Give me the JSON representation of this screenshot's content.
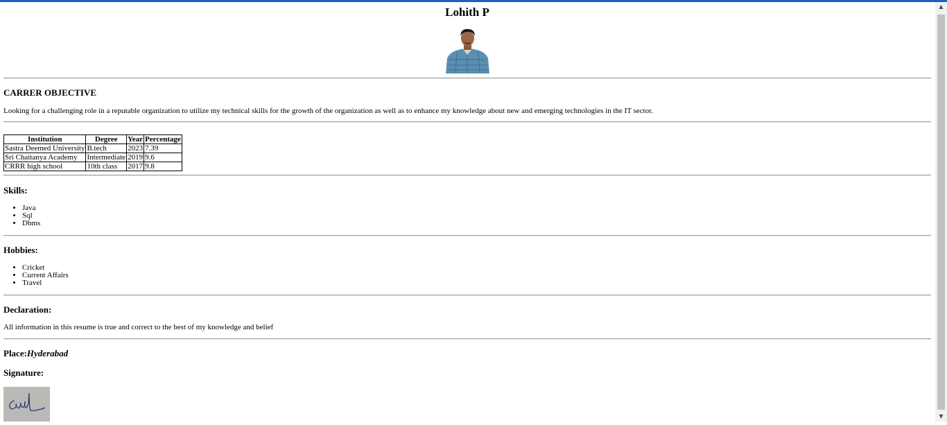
{
  "resume": {
    "name": "Lohith P",
    "objective_heading": "CARRER OBJECTIVE",
    "objective_text": "Looking for a challenging role in a reputable organization to utilize my technical skills for the growth of the organization as well as to enhance my knowledge about new and emerging technologies in the IT sector.",
    "education": {
      "headers": [
        "Institution",
        "Degree",
        "Year",
        "Percentage"
      ],
      "rows": [
        [
          "Sastra Deemed University",
          "B.tech",
          "2023",
          "7.39"
        ],
        [
          "Sri Chaitanya Academy",
          "Intermediate",
          "2019",
          "9.6"
        ],
        [
          "CRRR high school",
          "10th class",
          "2017",
          "9.8"
        ]
      ]
    },
    "skills_heading": "Skills:",
    "skills": [
      "Java",
      "Sql",
      "Dbms"
    ],
    "hobbies_heading": "Hobbies:",
    "hobbies": [
      "Cricket",
      "Current Affairs",
      "Travel"
    ],
    "declaration_heading": "Declaration:",
    "declaration_text": "All information in this resume is true and correct to the best of my knowledge and belief",
    "place_label": "Place:",
    "place_value": "Hyderabad",
    "signature_label": "Signature:"
  },
  "icons": {
    "scroll_up": "scroll-up-arrow",
    "scroll_down": "scroll-down-arrow"
  },
  "colors": {
    "top_bar": "#1c5fc2"
  }
}
